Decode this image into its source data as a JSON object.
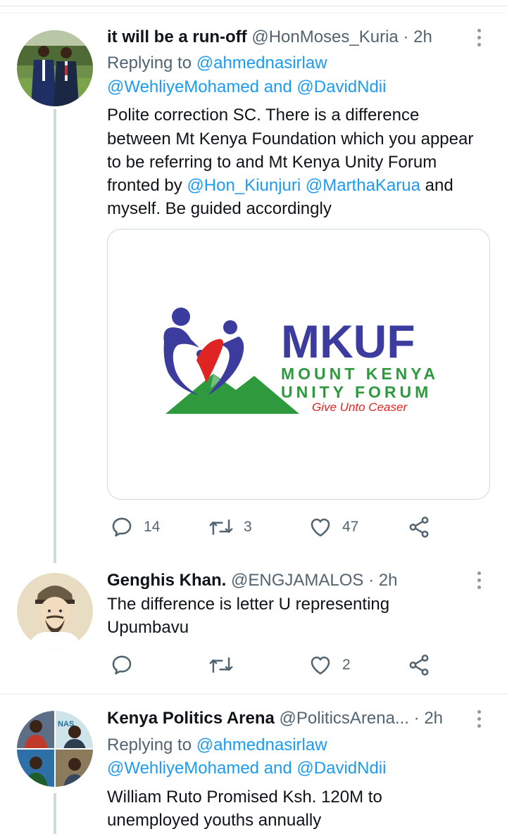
{
  "tweets": [
    {
      "name": "it will be a run-off",
      "handle": "@HonMoses_Kuria",
      "sep": " · ",
      "time": "2h",
      "replying_label": "Replying to",
      "reply_to_1": "@ahmednasirlaw",
      "reply_to_2": "@WehliyeMohamed",
      "reply_and": "and",
      "reply_to_3": "@DavidNdii",
      "body_line1": "Polite correction SC. There is a difference",
      "body_line2": "between Mt Kenya Foundation which you appear",
      "body_line3": "to be referring to and Mt Kenya Unity Forum",
      "body_line4_pre": "fronted by",
      "mention_1": "@Hon_Kiunjuri",
      "mention_2": "@MarthaKarua",
      "body_line4_post": "and",
      "body_line5": "myself.  Be guided accordingly",
      "image": {
        "logo_big": "MKUF",
        "logo_line1": "MOUNT KENYA",
        "logo_line2": "UNITY FORUM",
        "logo_tagline": "Give Unto Ceaser",
        "colors": {
          "blue": "#3b3c9e",
          "green": "#2e9a3d",
          "red": "#e02424"
        }
      },
      "stats": {
        "replies": "14",
        "retweets": "3",
        "likes": "47"
      }
    },
    {
      "name": "Genghis Khan.",
      "handle": "@ENGJAMALOS",
      "sep": " · ",
      "time": "2h",
      "body_line1": "The difference is letter U representing",
      "body_line2": "Upumbavu",
      "stats": {
        "replies": "",
        "retweets": "",
        "likes": "2"
      }
    },
    {
      "name": "Kenya Politics Arena",
      "handle": "@PoliticsArena...",
      "sep": " · ",
      "time": "2h",
      "replying_label": "Replying to",
      "reply_to_1": "@ahmednasirlaw",
      "reply_to_2": "@WehliyeMohamed",
      "reply_and": "and",
      "reply_to_3": "@DavidNdii",
      "body_line1": "William Ruto Promised Ksh. 120M to",
      "body_line2": "unemployed youths annually"
    }
  ],
  "icons": {
    "reply": "reply-icon",
    "retweet": "retweet-icon",
    "like": "heart-icon",
    "share": "share-icon",
    "more": "more-options-icon"
  },
  "colors": {
    "link": "#1d9bf0",
    "text": "#0f1419",
    "secondary": "#536471",
    "border": "#cfd9de"
  }
}
